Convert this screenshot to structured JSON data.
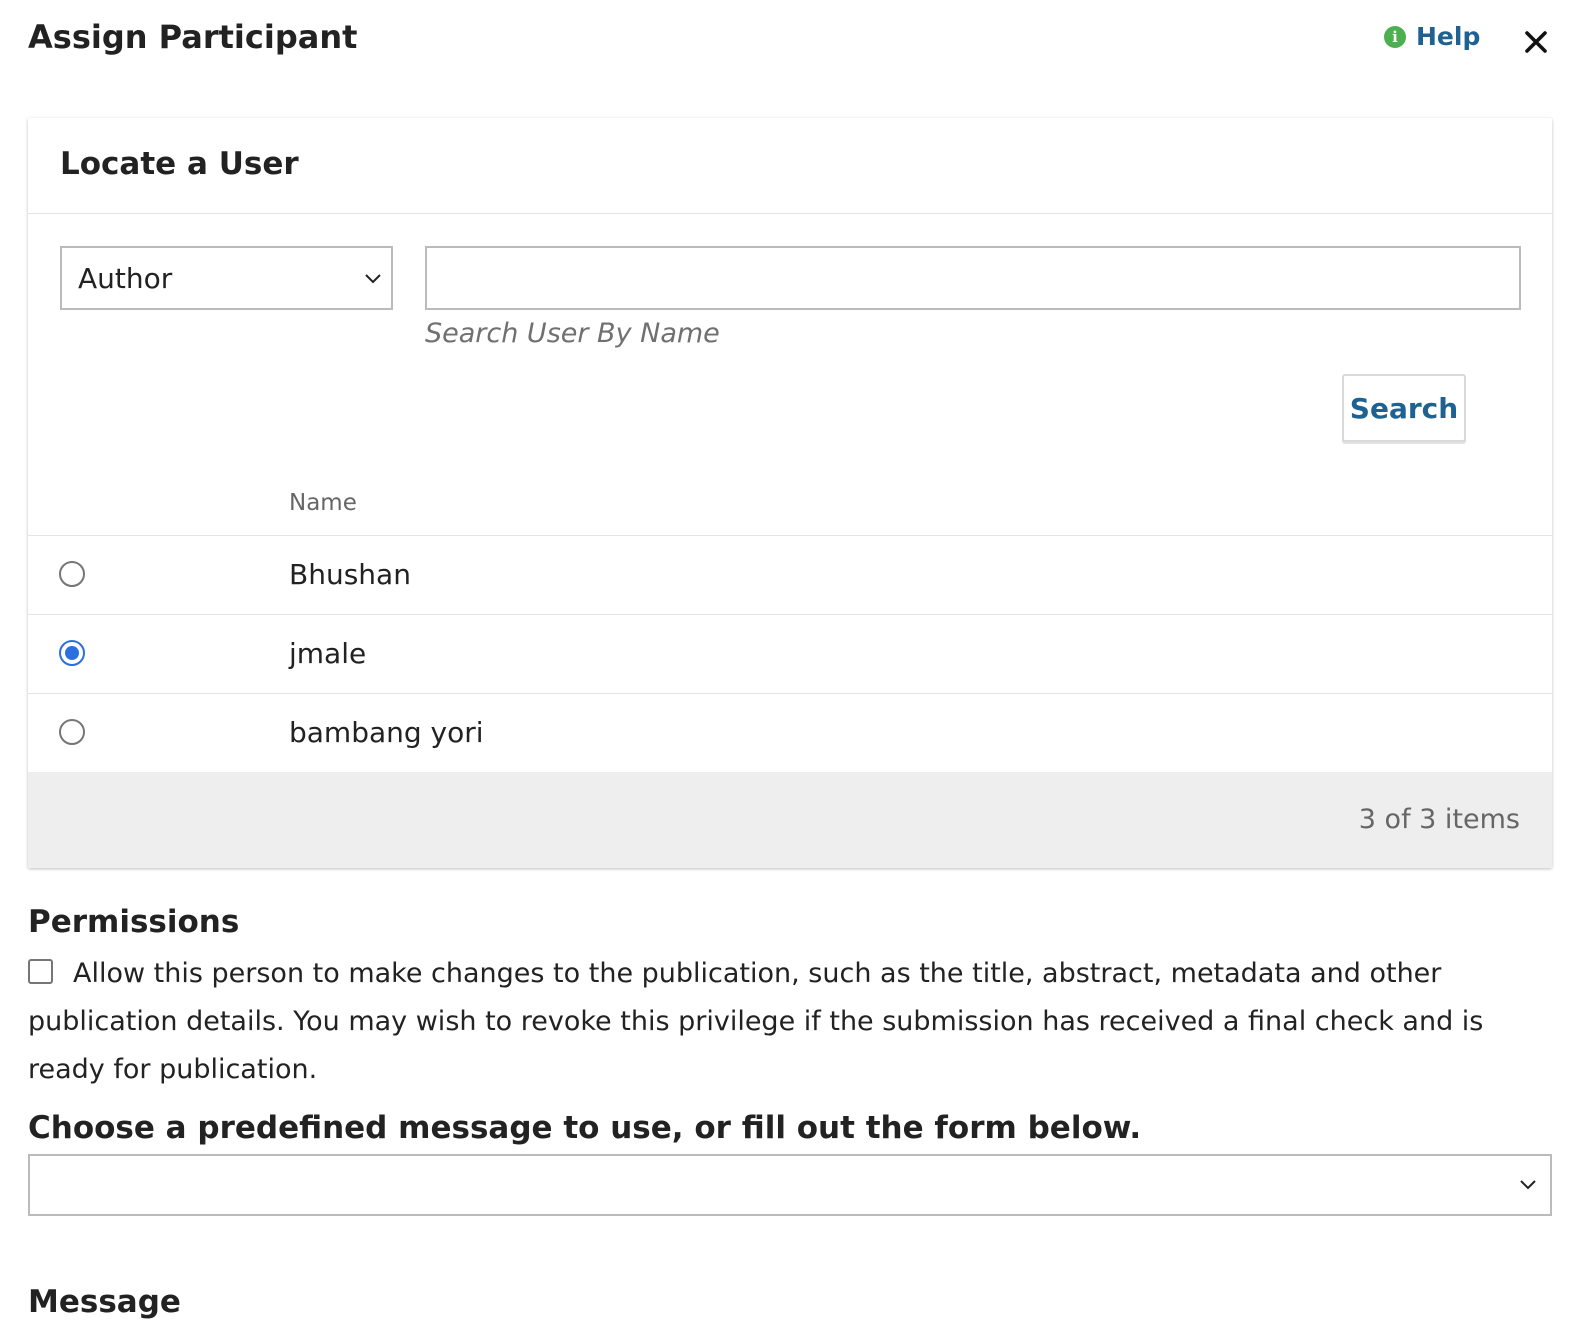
{
  "modal": {
    "title": "Assign Participant",
    "help_label": "Help",
    "close_icon": "close-icon"
  },
  "locate_user": {
    "title": "Locate a User",
    "role_select": {
      "selected": "Author"
    },
    "search_input": {
      "value": ""
    },
    "search_help": "Search User By Name",
    "search_button": "Search"
  },
  "users_table": {
    "column_name": "Name",
    "rows": [
      {
        "name": "Bhushan",
        "selected": false
      },
      {
        "name": "jmale",
        "selected": true
      },
      {
        "name": "bambang yori",
        "selected": false
      }
    ],
    "item_count": "3 of 3 items"
  },
  "permissions": {
    "title": "Permissions",
    "checkbox_checked": false,
    "text": "Allow this person to make changes to the publication, such as the title, abstract, metadata and other publication details. You may wish to revoke this privilege if the submission has received a final check and is ready for publication."
  },
  "template": {
    "label": "Choose a predefined message to use, or fill out the form below.",
    "selected": ""
  },
  "message": {
    "label": "Message"
  },
  "colors": {
    "link": "#1e6292",
    "help_icon": "#4caf50",
    "radio_selected": "#2c6fe0",
    "footer_bg": "#eeeeee"
  }
}
